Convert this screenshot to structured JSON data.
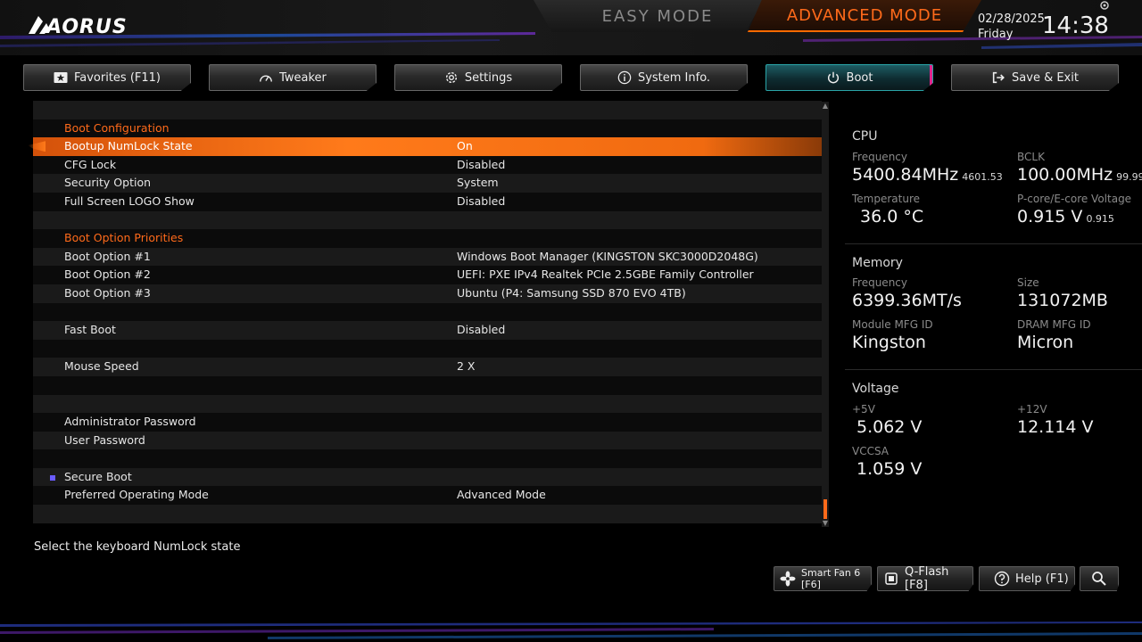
{
  "header": {
    "logo_text": "AORUS",
    "easy_mode": "EASY MODE",
    "advanced_mode": "ADVANCED MODE",
    "date": "02/28/2025",
    "day": "Friday",
    "time": "14:38",
    "accent_color": "#ff6a1a"
  },
  "tabs": [
    {
      "label": "Favorites (F11)",
      "icon": "star-icon"
    },
    {
      "label": "Tweaker",
      "icon": "gauge-icon"
    },
    {
      "label": "Settings",
      "icon": "gear-icon"
    },
    {
      "label": "System Info.",
      "icon": "info-icon"
    },
    {
      "label": "Boot",
      "icon": "power-icon",
      "active": true
    },
    {
      "label": "Save & Exit",
      "icon": "exit-icon"
    }
  ],
  "rows": [
    {
      "label": "",
      "value": ""
    },
    {
      "label": "Boot Configuration",
      "value": "",
      "type": "section"
    },
    {
      "label": "Bootup NumLock State",
      "value": "On",
      "selected": true
    },
    {
      "label": "CFG Lock",
      "value": "Disabled"
    },
    {
      "label": "Security Option",
      "value": "System"
    },
    {
      "label": "Full Screen LOGO Show",
      "value": "Disabled"
    },
    {
      "label": "",
      "value": ""
    },
    {
      "label": "Boot Option Priorities",
      "value": "",
      "type": "section"
    },
    {
      "label": "Boot Option #1",
      "value": "Windows Boot Manager (KINGSTON SKC3000D2048G)"
    },
    {
      "label": "Boot Option #2",
      "value": "UEFI: PXE IPv4 Realtek PCIe 2.5GBE Family Controller"
    },
    {
      "label": "Boot Option #3",
      "value": "Ubuntu (P4: Samsung SSD 870 EVO 4TB)"
    },
    {
      "label": "",
      "value": ""
    },
    {
      "label": "Fast Boot",
      "value": "Disabled"
    },
    {
      "label": "",
      "value": ""
    },
    {
      "label": "Mouse Speed",
      "value": "2 X"
    },
    {
      "label": "",
      "value": ""
    },
    {
      "label": "",
      "value": ""
    },
    {
      "label": "Administrator Password",
      "value": ""
    },
    {
      "label": "User Password",
      "value": ""
    },
    {
      "label": "",
      "value": ""
    },
    {
      "label": "Secure Boot",
      "value": "",
      "bullet": true
    },
    {
      "label": "Preferred Operating Mode",
      "value": "Advanced Mode"
    },
    {
      "label": "",
      "value": ""
    }
  ],
  "hint": "Select the keyboard NumLock state",
  "panel": {
    "cpu": {
      "title": "CPU",
      "frequency_label": "Frequency",
      "frequency": "5400.84MHz",
      "frequency_sub": "4601.53",
      "bclk_label": "BCLK",
      "bclk": "100.00MHz",
      "bclk_sub": "99.99",
      "temp_label": "Temperature",
      "temp": "36.0 °C",
      "voltage_label": "P-core/E-core Voltage",
      "voltage": "0.915 V",
      "voltage_sub": "0.915"
    },
    "memory": {
      "title": "Memory",
      "frequency_label": "Frequency",
      "frequency": "6399.36MT/s",
      "size_label": "Size",
      "size": "131072MB",
      "module_label": "Module MFG ID",
      "module": "Kingston",
      "dram_label": "DRAM MFG ID",
      "dram": "Micron"
    },
    "voltage": {
      "title": "Voltage",
      "v5_label": "+5V",
      "v5": "5.062 V",
      "v12_label": "+12V",
      "v12": "12.114 V",
      "vccsa_label": "VCCSA",
      "vccsa": "1.059 V"
    }
  },
  "bottom": {
    "smart_fan": "Smart Fan 6 [F6]",
    "qflash": "Q-Flash [F8]",
    "help": "Help (F1)"
  }
}
